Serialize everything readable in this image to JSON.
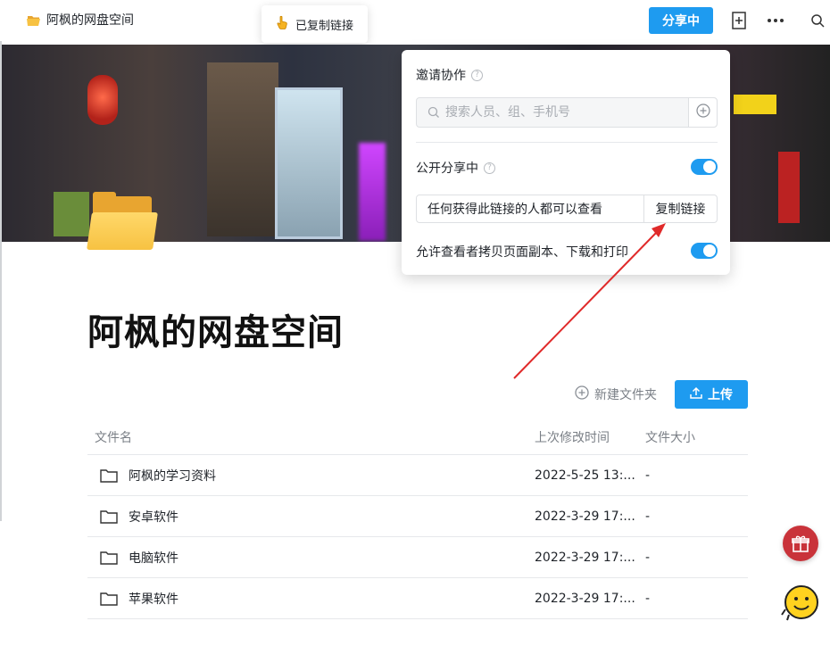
{
  "header": {
    "breadcrumb": "阿枫的网盘空间",
    "share_button": "分享中"
  },
  "toast": {
    "message": "已复制链接"
  },
  "page": {
    "title": "阿枫的网盘空间",
    "new_folder": "新建文件夹",
    "upload": "上传"
  },
  "table": {
    "columns": [
      "文件名",
      "上次修改时间",
      "文件大小"
    ],
    "rows": [
      {
        "name": "阿枫的学习资料",
        "modified": "2022-5-25 13:...",
        "size": "-"
      },
      {
        "name": "安卓软件",
        "modified": "2022-3-29 17:...",
        "size": "-"
      },
      {
        "name": "电脑软件",
        "modified": "2022-3-29 17:...",
        "size": "-"
      },
      {
        "name": "苹果软件",
        "modified": "2022-3-29 17:...",
        "size": "-"
      }
    ]
  },
  "share_popover": {
    "invite_label": "邀请协作",
    "search_placeholder": "搜索人员、组、手机号",
    "public_share_label": "公开分享中",
    "public_share_on": true,
    "link_permission": "任何获得此链接的人都可以查看",
    "copy_link": "复制链接",
    "allow_copy_label": "允许查看者拷贝页面副本、下载和打印",
    "allow_copy_on": true
  },
  "icons": {
    "breadcrumb": "folder-open-icon",
    "toast": "hand-pointer-icon",
    "topbar": [
      "add-page-icon",
      "more-icon",
      "search-icon"
    ],
    "new_folder": "plus-circle-icon",
    "upload": "upload-icon",
    "floating": [
      "gift-icon",
      "mascot-icon"
    ]
  },
  "colors": {
    "accent": "#1e9bf0",
    "annotation_arrow": "#e02a2a",
    "gift": "#c9333a"
  }
}
